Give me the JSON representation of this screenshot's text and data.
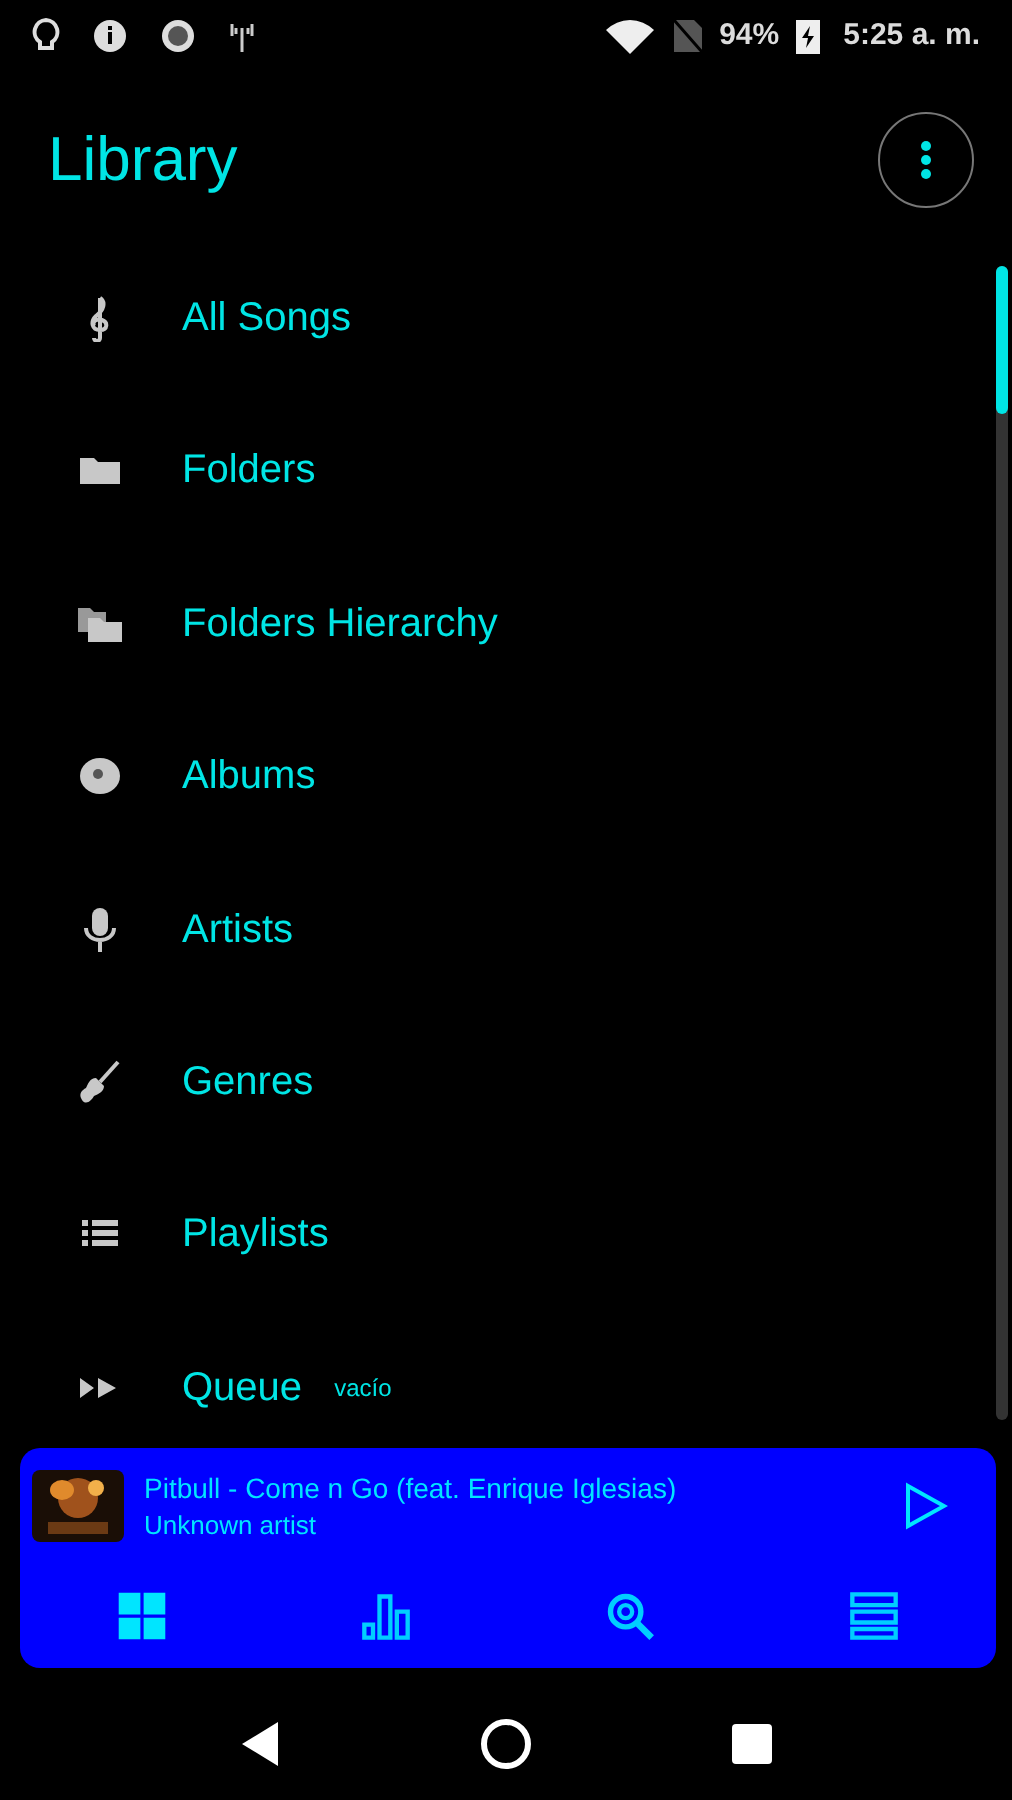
{
  "status_bar": {
    "battery": "94%",
    "time": "5:25 a. m."
  },
  "header": {
    "title": "Library"
  },
  "items": [
    {
      "label": "All Songs",
      "kind": "clef"
    },
    {
      "label": "Folders",
      "kind": "folder"
    },
    {
      "label": "Folders Hierarchy",
      "kind": "folders"
    },
    {
      "label": "Albums",
      "kind": "disc"
    },
    {
      "label": "Artists",
      "kind": "mic"
    },
    {
      "label": "Genres",
      "kind": "guitar"
    },
    {
      "label": "Playlists",
      "kind": "list"
    },
    {
      "label": "Queue",
      "kind": "forward",
      "note": "vacío"
    }
  ],
  "player": {
    "title": "Pitbull - Come n Go (feat. Enrique Iglesias)",
    "artist": "Unknown artist"
  },
  "tabs": [
    {
      "kind": "grid",
      "selected": true
    },
    {
      "kind": "bars",
      "selected": false
    },
    {
      "kind": "search",
      "selected": false
    },
    {
      "kind": "stack",
      "selected": false
    }
  ]
}
